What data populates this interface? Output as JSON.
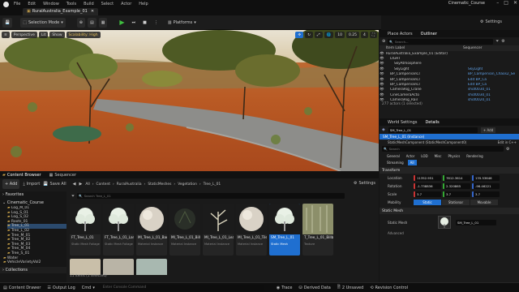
{
  "menu": {
    "items": [
      "File",
      "Edit",
      "Window",
      "Tools",
      "Build",
      "Select",
      "Actor",
      "Help"
    ],
    "project": "Cinematic_Course"
  },
  "tab": {
    "label": "RuralAustralia_Example_01"
  },
  "toolbar": {
    "mode": "Selection Mode",
    "platforms": "Platforms",
    "settings": "Settings"
  },
  "viewport": {
    "perspective": "Perspective",
    "lit": "Lit",
    "show": "Show",
    "scalability": "Scalability: High",
    "angle": "10",
    "scale": "0.25",
    "num": "4"
  },
  "outliner": {
    "tabs": [
      "Place Actors",
      "Outliner"
    ],
    "search_placeholder": "Search...",
    "col_label": "Item Label",
    "col_sequencer": "Sequencer",
    "rows": [
      {
        "label": "RuralAustralia_Example_01 (Editor)",
        "type": "",
        "indent": 0
      },
      {
        "label": "LIGHT",
        "type": "",
        "indent": 1
      },
      {
        "label": "SkyAtmosphere",
        "type": "",
        "indent": 2
      },
      {
        "label": "SkyLight",
        "type": "SkyLight",
        "indent": 2
      },
      {
        "label": "BP_CampervanCl",
        "type": "BP_Campervan_Chaos2_Se",
        "indent": 1
      },
      {
        "label": "BP_CampervanCl",
        "type": "Edit BP_Ca",
        "indent": 1
      },
      {
        "label": "BP_CampervanCl",
        "type": "Edit BP_Ca",
        "indent": 1
      },
      {
        "label": "CameraRig_Crane",
        "type": "shot0030_01",
        "indent": 1
      },
      {
        "label": "CineCameraActo",
        "type": "shot0030_01",
        "indent": 1
      },
      {
        "label": "CameraRig_Rail",
        "type": "shot0020_01",
        "indent": 1
      },
      {
        "label": "CineCameraActo",
        "type": "CineCamera",
        "indent": 1
      },
      {
        "label": "SM_Tree_L_01",
        "type": "StaticMesh",
        "indent": 1
      }
    ],
    "count": "277 actors (1 selected)"
  },
  "details": {
    "tabs": [
      "World Settings",
      "Details"
    ],
    "selected": "SM_Tree_L_01",
    "add": "+ Add",
    "instance": "SM_Tree_L_01 (Instance)",
    "component": "StaticMeshComponent (StaticMeshComponent0)",
    "edit_cpp": "Edit in C++",
    "search_placeholder": "Search",
    "cat_tabs": [
      "General",
      "Actor",
      "LOD",
      "Misc",
      "Physics",
      "Rendering"
    ],
    "cat_tabs2": [
      "Streaming",
      "All"
    ],
    "transform": "Transform",
    "location_label": "Location",
    "location": [
      "11352.951",
      "7812.3614",
      "135.53646"
    ],
    "rotation_label": "Rotation",
    "rotation": [
      "-1.738836",
      "2.320865",
      "-96.46221"
    ],
    "scale_label": "Scale",
    "scale": [
      "3.7",
      "3.7",
      "3.7"
    ],
    "mobility_label": "Mobility",
    "mobility": [
      "Static",
      "Stationar",
      "Movable"
    ],
    "static_mesh_section": "Static Mesh",
    "static_mesh_label": "Static Mesh",
    "static_mesh_value": "SM_Tree_L_01",
    "advanced": "Advanced"
  },
  "content_browser": {
    "tabs": [
      "Content Browser",
      "Sequencer"
    ],
    "add": "+ Add",
    "import": "Import",
    "save_all": "Save All",
    "breadcrumb": [
      "All",
      "Content",
      "RuralAustralia",
      "StaticMeshes",
      "Vegetation",
      "Tree_L_01"
    ],
    "settings": "Settings",
    "favorites": "Favorites",
    "project": "Cinematic_Course",
    "tree": [
      "Log_M_01",
      "Log_S_01",
      "Log_S_02",
      "Roots_01",
      "Tree_L_01",
      "Tree_L_02",
      "Tree_M_01",
      "Tree_M_02",
      "Tree_M_03",
      "Tree_M_04",
      "Tree_S_01",
      "Water",
      "VehicleVarietyVol2"
    ],
    "collections": "Collections",
    "search_placeholder": "Search Tree_L_01",
    "assets": [
      {
        "name": "FT_Tree_L_01",
        "type": "Static Mesh Foliage"
      },
      {
        "name": "FT_Tree_L_01_Large",
        "type": "Static Mesh Foliage"
      },
      {
        "name": "MI_Tree_L_01_Bark",
        "type": "Material Instance"
      },
      {
        "name": "MI_Tree_L_01_Billboard",
        "type": "Material Instance"
      },
      {
        "name": "MI_Tree_L_01_Leaves",
        "type": "Material Instance"
      },
      {
        "name": "MI_Tree_L_01_Tile",
        "type": "Material Instance"
      },
      {
        "name": "SM_Tree_L_01",
        "type": "Static Mesh"
      },
      {
        "name": "T_Tree_L_01_Billboard_CA",
        "type": "Texture"
      }
    ],
    "count": "11 items (1 selected)"
  },
  "status": {
    "content_drawer": "Content Drawer",
    "output_log": "Output Log",
    "cmd": "Cmd",
    "console_placeholder": "Enter Console Command",
    "trace": "Trace",
    "derived": "Derived Data",
    "unsaved": "2 Unsaved",
    "revision": "Revision Control"
  },
  "colors": {
    "accent": "#1f6fd0",
    "play": "#3fbf3f",
    "selection": "#2b4a6d",
    "folder": "#c9a24a"
  }
}
